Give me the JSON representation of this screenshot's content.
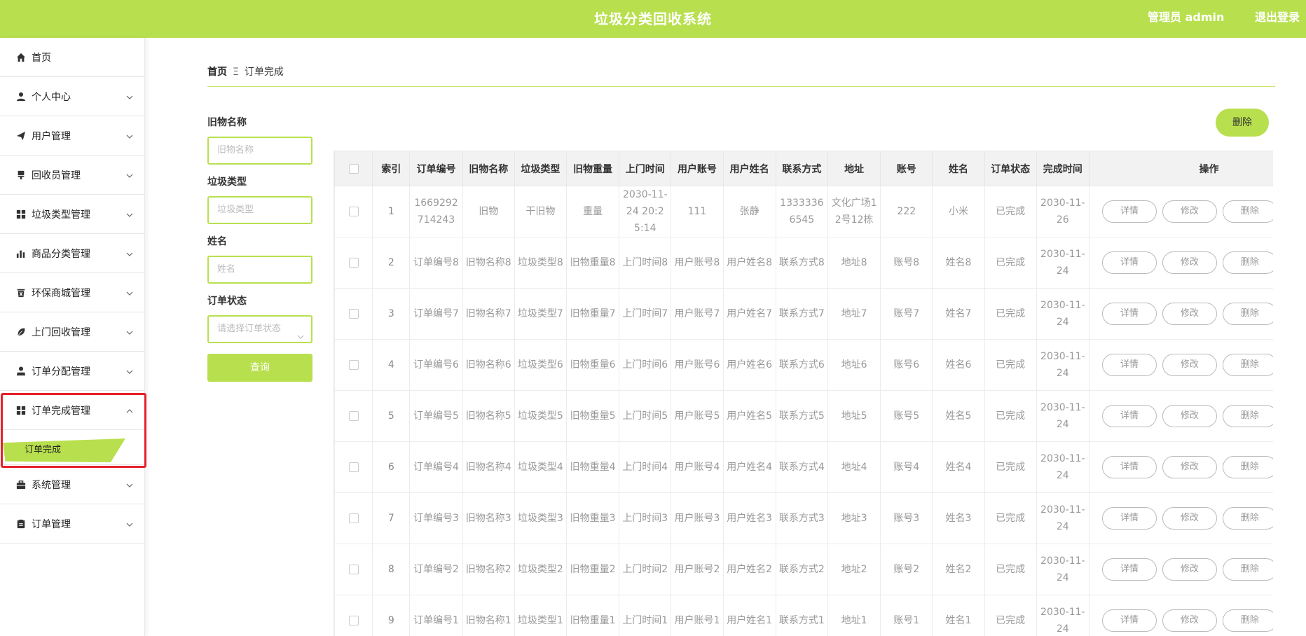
{
  "header": {
    "title": "垃圾分类回收系统",
    "admin": "管理员 admin",
    "logout": "退出登录"
  },
  "sidebar": {
    "items": [
      {
        "label": "首页",
        "icon": "home-icon",
        "has_arrow": false
      },
      {
        "label": "个人中心",
        "icon": "person-icon",
        "has_arrow": true
      },
      {
        "label": "用户管理",
        "icon": "paper-plane-icon",
        "has_arrow": true
      },
      {
        "label": "回收员管理",
        "icon": "brush-icon",
        "has_arrow": true
      },
      {
        "label": "垃圾类型管理",
        "icon": "grid-icon",
        "has_arrow": true
      },
      {
        "label": "商品分类管理",
        "icon": "bar-chart-icon",
        "has_arrow": true
      },
      {
        "label": "环保商城管理",
        "icon": "trash-can-icon",
        "has_arrow": true
      },
      {
        "label": "上门回收管理",
        "icon": "leaf-icon",
        "has_arrow": true
      },
      {
        "label": "订单分配管理",
        "icon": "user-tie-icon",
        "has_arrow": true
      },
      {
        "label": "订单完成管理",
        "icon": "grid-icon",
        "has_arrow": true,
        "expanded": true
      },
      {
        "label": "系统管理",
        "icon": "briefcase-icon",
        "has_arrow": true
      },
      {
        "label": "订单管理",
        "icon": "clipboard-icon",
        "has_arrow": true
      }
    ],
    "submenu_label": "订单完成"
  },
  "breadcrumb": {
    "home": "首页",
    "separator": "Ξ",
    "current": "订单完成"
  },
  "filters": [
    {
      "label": "旧物名称",
      "placeholder": "旧物名称",
      "type": "input"
    },
    {
      "label": "垃圾类型",
      "placeholder": "垃圾类型",
      "type": "input"
    },
    {
      "label": "姓名",
      "placeholder": "姓名",
      "type": "input"
    },
    {
      "label": "订单状态",
      "placeholder": "请选择订单状态",
      "type": "select"
    }
  ],
  "query_button": "查询",
  "delete_button": "删除",
  "table": {
    "columns": [
      "索引",
      "订单编号",
      "旧物名称",
      "垃圾类型",
      "旧物重量",
      "上门时间",
      "用户账号",
      "用户姓名",
      "联系方式",
      "地址",
      "账号",
      "姓名",
      "订单状态",
      "完成时间",
      "操作"
    ],
    "rows": [
      [
        "1",
        "1669292714243",
        "旧物",
        "干旧物",
        "重量",
        "2030-11-24 20:25:14",
        "111",
        "张静",
        "13333366545",
        "文化广场12号12栋",
        "222",
        "小米",
        "已完成",
        "2030-11-26"
      ],
      [
        "2",
        "订单编号8",
        "旧物名称8",
        "垃圾类型8",
        "旧物重量8",
        "上门时间8",
        "用户账号8",
        "用户姓名8",
        "联系方式8",
        "地址8",
        "账号8",
        "姓名8",
        "已完成",
        "2030-11-24"
      ],
      [
        "3",
        "订单编号7",
        "旧物名称7",
        "垃圾类型7",
        "旧物重量7",
        "上门时间7",
        "用户账号7",
        "用户姓名7",
        "联系方式7",
        "地址7",
        "账号7",
        "姓名7",
        "已完成",
        "2030-11-24"
      ],
      [
        "4",
        "订单编号6",
        "旧物名称6",
        "垃圾类型6",
        "旧物重量6",
        "上门时间6",
        "用户账号6",
        "用户姓名6",
        "联系方式6",
        "地址6",
        "账号6",
        "姓名6",
        "已完成",
        "2030-11-24"
      ],
      [
        "5",
        "订单编号5",
        "旧物名称5",
        "垃圾类型5",
        "旧物重量5",
        "上门时间5",
        "用户账号5",
        "用户姓名5",
        "联系方式5",
        "地址5",
        "账号5",
        "姓名5",
        "已完成",
        "2030-11-24"
      ],
      [
        "6",
        "订单编号4",
        "旧物名称4",
        "垃圾类型4",
        "旧物重量4",
        "上门时间4",
        "用户账号4",
        "用户姓名4",
        "联系方式4",
        "地址4",
        "账号4",
        "姓名4",
        "已完成",
        "2030-11-24"
      ],
      [
        "7",
        "订单编号3",
        "旧物名称3",
        "垃圾类型3",
        "旧物重量3",
        "上门时间3",
        "用户账号3",
        "用户姓名3",
        "联系方式3",
        "地址3",
        "账号3",
        "姓名3",
        "已完成",
        "2030-11-24"
      ],
      [
        "8",
        "订单编号2",
        "旧物名称2",
        "垃圾类型2",
        "旧物重量2",
        "上门时间2",
        "用户账号2",
        "用户姓名2",
        "联系方式2",
        "地址2",
        "账号2",
        "姓名2",
        "已完成",
        "2030-11-24"
      ],
      [
        "9",
        "订单编号1",
        "旧物名称1",
        "垃圾类型1",
        "旧物重量1",
        "上门时间1",
        "用户账号1",
        "用户姓名1",
        "联系方式1",
        "地址1",
        "账号1",
        "姓名1",
        "已完成",
        "2030-11-24"
      ]
    ],
    "actions": [
      "详情",
      "修改",
      "删除"
    ]
  },
  "colors": {
    "accent": "#b8e04e",
    "highlight": "#e5212a"
  }
}
